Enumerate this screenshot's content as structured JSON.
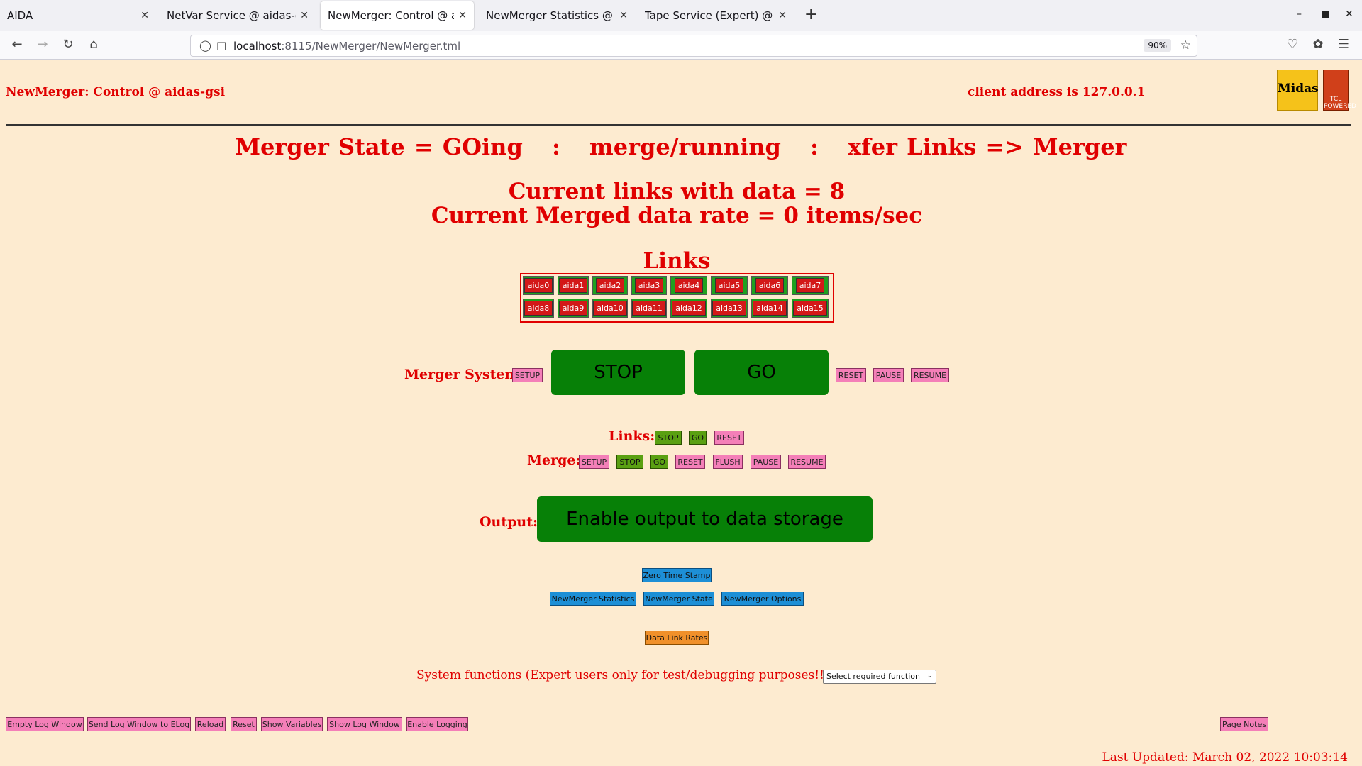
{
  "browser": {
    "tabs": [
      {
        "label": "AIDA"
      },
      {
        "label": "NetVar Service @ aidas-gsi"
      },
      {
        "label": "NewMerger: Control @ aidas"
      },
      {
        "label": "NewMerger Statistics @ aida"
      },
      {
        "label": "Tape Service (Expert) @ aida"
      }
    ],
    "url_host": "localhost",
    "url_path": ":8115/NewMerger/NewMerger.tml",
    "zoom": "90%"
  },
  "header": {
    "title": "NewMerger: Control @ aidas-gsi",
    "client": "client address is 127.0.0.1",
    "logo_midas": "Midas",
    "logo_tcl": "TCL POWERED"
  },
  "status": {
    "state": "Merger State = GOing",
    "sep1": ":",
    "mode": "merge/running",
    "sep2": ":",
    "xfer": "xfer Links => Merger",
    "links_with_data": "Current links with data = 8",
    "data_rate": "Current Merged data rate = 0 items/sec"
  },
  "links": {
    "title": "Links",
    "items": [
      "aida0",
      "aida1",
      "aida2",
      "aida3",
      "aida4",
      "aida5",
      "aida6",
      "aida7",
      "aida8",
      "aida9",
      "aida10",
      "aida11",
      "aida12",
      "aida13",
      "aida14",
      "aida15"
    ]
  },
  "merger_system": {
    "label": "Merger System:",
    "setup": "SETUP",
    "stop": "STOP",
    "go": "GO",
    "reset": "RESET",
    "pause": "PAUSE",
    "resume": "RESUME"
  },
  "links_ctl": {
    "label": "Links:",
    "stop": "STOP",
    "go": "GO",
    "reset": "RESET"
  },
  "merge_ctl": {
    "label": "Merge:",
    "setup": "SETUP",
    "stop": "STOP",
    "go": "GO",
    "reset": "RESET",
    "flush": "FLUSH",
    "pause": "PAUSE",
    "resume": "RESUME"
  },
  "output": {
    "label": "Output:",
    "button": "Enable output to data storage"
  },
  "nav": {
    "zero_ts": "Zero Time Stamp",
    "stats": "NewMerger Statistics",
    "state": "NewMerger State",
    "options": "NewMerger Options",
    "rates": "Data Link Rates"
  },
  "system": {
    "label": "System functions (Expert users only for test/debugging purposes!!!)",
    "select": "Select required function"
  },
  "footer": {
    "empty_log": "Empty Log Window",
    "send_log": "Send Log Window to ELog",
    "reload": "Reload",
    "reset": "Reset",
    "show_vars": "Show Variables",
    "show_log": "Show Log Window",
    "enable_logging": "Enable Logging",
    "page_notes": "Page Notes",
    "last_updated": "Last Updated: March 02, 2022 10:03:14"
  }
}
